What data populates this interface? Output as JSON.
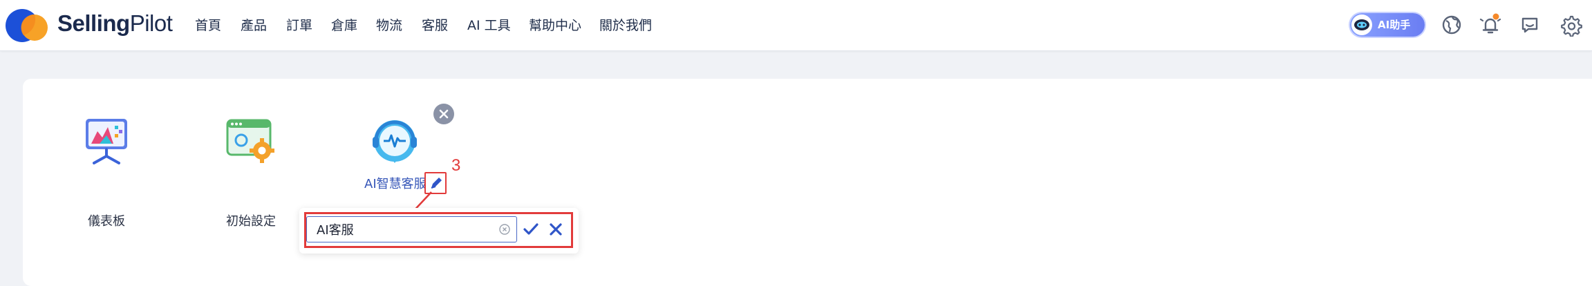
{
  "brand": {
    "bold": "Selling",
    "light": "Pilot"
  },
  "nav": [
    {
      "label": "首頁"
    },
    {
      "label": "產品"
    },
    {
      "label": "訂單"
    },
    {
      "label": "倉庫"
    },
    {
      "label": "物流"
    },
    {
      "label": "客服"
    },
    {
      "label": "AI 工具"
    },
    {
      "label": "幫助中心"
    },
    {
      "label": "關於我們"
    }
  ],
  "header_actions": {
    "ai_assistant_label": "AI助手",
    "icons": [
      "globe-icon",
      "bell-icon",
      "chat-icon",
      "gear-icon"
    ],
    "notification_dot_color": "#f5892a"
  },
  "apps": [
    {
      "name": "儀表板",
      "icon": "dashboard-icon"
    },
    {
      "name": "初始設定",
      "icon": "settings-window-icon"
    },
    {
      "name": "AI智慧客服",
      "icon": "ai-support-icon"
    }
  ],
  "annotation": {
    "step": "3",
    "color": "#e23b3b"
  },
  "rename_popover": {
    "value": "AI客服",
    "confirm_icon": "check-icon",
    "cancel_icon": "close-icon"
  },
  "colors": {
    "accent": "#3656b8",
    "brand_blue": "#1c50d8",
    "brand_orange": "#f7a227"
  }
}
